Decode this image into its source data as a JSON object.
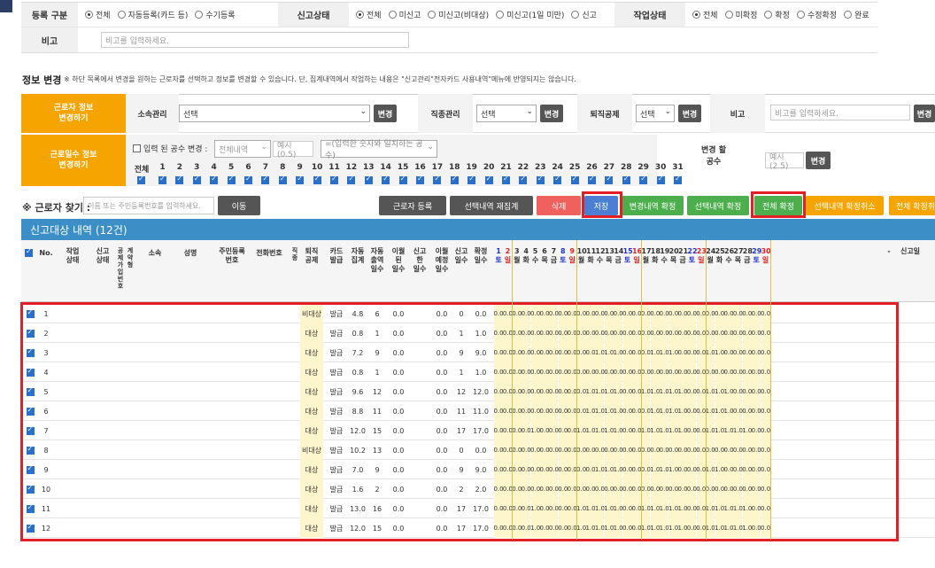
{
  "filters": {
    "reg_label": "등록 구분",
    "reg_options": [
      "전체",
      "자동등록(카드 등)",
      "수기등록"
    ],
    "report_label": "신고상태",
    "report_options": [
      "전체",
      "미신고",
      "미신고(비대상)",
      "미신고(1일 미만)",
      "신고"
    ],
    "work_label": "작업상태",
    "work_options": [
      "전체",
      "미확정",
      "확정",
      "수정확정",
      "완료"
    ],
    "memo_label": "비고",
    "memo_placeholder": "비고를 입력하세요."
  },
  "info_change": {
    "title": "정보 변경",
    "note": "※ 하단 목록에서 변경을 원하는 근로자를 선택하고 정보를 변경할 수 있습니다. 단, 집계내역에서 작업하는 내용은 \"신고관리\"전자카드 사용내역\"메뉴에 반영되지는 않습니다.",
    "worker_info_label": "근로자 정보\n변경하기",
    "dept_label": "소속관리",
    "dept_value": "선택",
    "change": "변경",
    "job_label": "직종관리",
    "job_value": "선택",
    "retire_label": "퇴직공제",
    "retire_value": "선택",
    "memo_label": "비고",
    "memo_placeholder": "비고를 입력하세요.",
    "workday_label": "근로일수 정보\n변경하기",
    "input_check": "입력 된 공수 변경 :",
    "all_select": "전체내역",
    "example": "예시(0.5)",
    "match_select": "=(입력한 숫자와 일치하는 공수)",
    "all_label": "전체",
    "days": [
      "1",
      "2",
      "3",
      "4",
      "5",
      "6",
      "7",
      "8",
      "9",
      "10",
      "11",
      "12",
      "13",
      "14",
      "15",
      "16",
      "17",
      "18",
      "19",
      "20",
      "21",
      "22",
      "23",
      "24",
      "25",
      "26",
      "27",
      "28",
      "29",
      "30",
      "31"
    ],
    "change_gongsu_label": "변경 할\n공수",
    "example2": "예시(2.5)"
  },
  "search": {
    "label": "※ 근로자 찾기 :",
    "placeholder": "이름 또는 주민등록번호를 입력하세요.",
    "move": "이동"
  },
  "buttons": {
    "register": "근로자 등록",
    "recalc": "선택내역 재집계",
    "delete": "삭제",
    "save": "저장",
    "confirm_changes": "변경내역 확정",
    "confirm_selected": "선택내역 확정",
    "confirm_all": "전체 확정",
    "cancel_selected": "선택내역 확정취소",
    "cancel_all": "전체 확정취"
  },
  "list": {
    "title": "신고대상 내역 (12건)",
    "headers": {
      "no": "No.",
      "work_status": "작업\n상태",
      "report_status": "신고\n상태",
      "deduct": "공\n제\n가\n입\n번\n호",
      "gong": "계\n약\n형",
      "dept": "소속",
      "name": "성명",
      "rrn": "주민등록\n번호",
      "phone": "전화번호",
      "jik": "직\n종",
      "retire": "퇴직\n공제",
      "card": "카드\n발급",
      "auto": "자동\n집계",
      "auto_days": "자동\n출역\n일수",
      "mod": "이월\n된\n일수",
      "rep_limit": "신고\n한\n일수",
      "mod2": "이월\n예정\n일수",
      "rep_days": "신고\n일수",
      "confirm_days": "확정\n일수",
      "dash": "-",
      "report_memo": "신고일"
    },
    "calendar": [
      {
        "d": "1",
        "w": "토",
        "c": "blue"
      },
      {
        "d": "2",
        "w": "일",
        "c": "red"
      },
      {
        "d": "3",
        "w": "월"
      },
      {
        "d": "4",
        "w": "화"
      },
      {
        "d": "5",
        "w": "수"
      },
      {
        "d": "6",
        "w": "목"
      },
      {
        "d": "7",
        "w": "금"
      },
      {
        "d": "8",
        "w": "토",
        "c": "blue"
      },
      {
        "d": "9",
        "w": "일",
        "c": "red"
      },
      {
        "d": "10",
        "w": "월"
      },
      {
        "d": "11",
        "w": "화"
      },
      {
        "d": "12",
        "w": "수"
      },
      {
        "d": "13",
        "w": "목"
      },
      {
        "d": "14",
        "w": "금"
      },
      {
        "d": "15",
        "w": "토",
        "c": "blue"
      },
      {
        "d": "16",
        "w": "일",
        "c": "red"
      },
      {
        "d": "17",
        "w": "월"
      },
      {
        "d": "18",
        "w": "화"
      },
      {
        "d": "19",
        "w": "수"
      },
      {
        "d": "20",
        "w": "목"
      },
      {
        "d": "21",
        "w": "금"
      },
      {
        "d": "22",
        "w": "토",
        "c": "blue"
      },
      {
        "d": "23",
        "w": "일",
        "c": "red"
      },
      {
        "d": "24",
        "w": "월"
      },
      {
        "d": "25",
        "w": "화"
      },
      {
        "d": "26",
        "w": "수"
      },
      {
        "d": "27",
        "w": "목"
      },
      {
        "d": "28",
        "w": "금"
      },
      {
        "d": "29",
        "w": "토",
        "c": "blue"
      },
      {
        "d": "30",
        "w": "일",
        "c": "red"
      }
    ],
    "rows": [
      {
        "no": "1",
        "retire": "비대상",
        "card": "발급",
        "auto": "4.8",
        "autod": "6",
        "mod": "0.0",
        "lim": "0.0",
        "rep": "0",
        "conf": "0.0",
        "days": "0.0 0.0 0.0 0.0 0.0 0.0 0.0 0.0 0.0 0.0 0.0 0.0 0.0 0.0 0.0 0.0 0.0 0.0 0.0 0.0 0.0 0.0 0.0 0.0 0.0 0.0 0.0 0.0 0.0 0.0"
      },
      {
        "no": "2",
        "retire": "대상",
        "card": "발급",
        "auto": "0.8",
        "autod": "1",
        "mod": "0.0",
        "lim": "0.0",
        "rep": "1",
        "conf": "1.0",
        "days": "0.0 0.0 0.0 0.0 0.0 0.0 0.0 0.0 0.0 0.0 0.0 0.0 0.0 0.0 0.0 0.0 0.0 0.0 0.0 0.0 0.0 0.0 0.0 0.0 0.0 0.0 0.0 0.0 0.0 0.0"
      },
      {
        "no": "3",
        "retire": "대상",
        "card": "발급",
        "auto": "7.2",
        "autod": "9",
        "mod": "0.0",
        "lim": "0.0",
        "rep": "9",
        "conf": "9.0",
        "days": "0.0 0.0 0.0 0.0 0.0 0.0 0.0 0.0 0.0 0.0 0.0 1.0 1.0 1.0 0.0 0.0 0.0 1.0 1.0 1.0 0.0 0.0 0.0 1.0 1.0 0.0 0.0 0.0 0.0 0.0"
      },
      {
        "no": "4",
        "retire": "대상",
        "card": "발급",
        "auto": "0.8",
        "autod": "1",
        "mod": "0.0",
        "lim": "0.0",
        "rep": "1",
        "conf": "1.0",
        "days": "0.0 0.0 0.0 0.0 0.0 0.0 0.0 0.0 0.0 0.0 0.0 0.0 0.0 0.0 0.0 0.0 0.0 0.0 0.0 0.0 0.0 0.0 0.0 0.0 0.0 0.0 0.0 0.0 0.0 0.0"
      },
      {
        "no": "5",
        "retire": "대상",
        "card": "발급",
        "auto": "9.6",
        "autod": "12",
        "mod": "0.0",
        "lim": "0.0",
        "rep": "12",
        "conf": "12.0",
        "days": "0.0 0.0 0.0 0.0 0.0 0.0 0.0 0.0 0.0 0.0 1.0 1.0 1.0 1.0 0.0 0.0 1.0 1.0 1.0 1.0 1.0 0.0 0.0 1.0 1.0 1.0 0.0 0.0 0.0 0.0"
      },
      {
        "no": "6",
        "retire": "대상",
        "card": "발급",
        "auto": "8.8",
        "autod": "11",
        "mod": "0.0",
        "lim": "0.0",
        "rep": "11",
        "conf": "11.0",
        "days": "0.0 0.0 0.0 0.0 0.0 0.0 0.0 0.0 0.0 0.0 1.0 1.0 1.0 1.0 0.0 0.0 0.0 1.0 1.0 1.0 1.0 0.0 0.0 1.0 1.0 1.0 0.0 0.0 0.0 0.0"
      },
      {
        "no": "7",
        "retire": "대상",
        "card": "발급",
        "auto": "12.0",
        "autod": "15",
        "mod": "0.0",
        "lim": "0.0",
        "rep": "17",
        "conf": "17.0",
        "days": "0.0 0.0 0.0 0.0 1.0 0.0 0.0 0.0 0.0 1.0 1.0 1.0 1.0 1.0 0.0 0.0 1.0 1.0 1.0 1.0 1.0 0.0 0.0 1.0 1.0 1.0 1.0 1.0 0.0 0.0"
      },
      {
        "no": "8",
        "retire": "비대상",
        "card": "발급",
        "auto": "10.2",
        "autod": "13",
        "mod": "0.0",
        "lim": "0.0",
        "rep": "0",
        "conf": "0.0",
        "days": "0.0 0.0 0.0 0.0 0.0 0.0 0.0 0.0 0.0 0.0 0.0 0.0 0.0 0.0 0.0 0.0 0.0 0.0 0.0 0.0 0.0 0.0 0.0 0.0 0.0 0.0 0.0 0.0 0.0 0.0"
      },
      {
        "no": "9",
        "retire": "대상",
        "card": "발급",
        "auto": "7.0",
        "autod": "9",
        "mod": "0.0",
        "lim": "0.0",
        "rep": "9",
        "conf": "9.0",
        "days": "0.0 0.0 0.0 0.0 0.0 0.0 0.0 0.0 0.0 0.0 0.0 1.0 1.0 1.0 0.0 0.0 0.0 1.0 1.0 1.0 0.0 0.0 0.0 1.0 1.0 0.0 0.0 0.0 0.0 0.0"
      },
      {
        "no": "10",
        "retire": "대상",
        "card": "발급",
        "auto": "1.6",
        "autod": "2",
        "mod": "0.0",
        "lim": "0.0",
        "rep": "2",
        "conf": "2.0",
        "days": "0.0 0.0 0.0 0.0 0.0 0.0 0.0 0.0 0.0 0.0 0.0 0.0 0.0 0.0 0.0 0.0 0.0 0.0 0.0 0.0 0.0 0.0 0.0 0.0 0.0 0.0 0.0 0.0 0.0 0.0"
      },
      {
        "no": "11",
        "retire": "대상",
        "card": "발급",
        "auto": "13.0",
        "autod": "16",
        "mod": "0.0",
        "lim": "0.0",
        "rep": "17",
        "conf": "17.0",
        "days": "0.0 0.0 0.0 0.0 1.0 0.0 0.0 0.0 0.0 1.0 1.0 1.0 1.0 1.0 0.0 0.0 1.0 1.0 1.0 1.0 1.0 0.0 0.0 1.0 1.0 1.0 1.0 1.0 0.0 0.0"
      },
      {
        "no": "12",
        "retire": "대상",
        "card": "발급",
        "auto": "12.0",
        "autod": "15",
        "mod": "0.0",
        "lim": "0.0",
        "rep": "17",
        "conf": "17.0",
        "days": "0.0 0.0 0.0 0.0 1.0 0.0 0.0 0.0 0.0 1.0 1.0 1.0 1.0 1.0 0.0 0.0 1.0 1.0 1.0 1.0 1.0 0.0 0.0 1.0 1.0 1.0 1.0 1.0 0.0 0.0"
      }
    ]
  },
  "colors": {
    "orange": "#f6a500",
    "header_bar": "#3b8fc6",
    "highlight": "#e31e24",
    "save": "#4a7fd4",
    "green": "#4cae4c",
    "red_btn": "#f0605d",
    "dark": "#555555"
  }
}
